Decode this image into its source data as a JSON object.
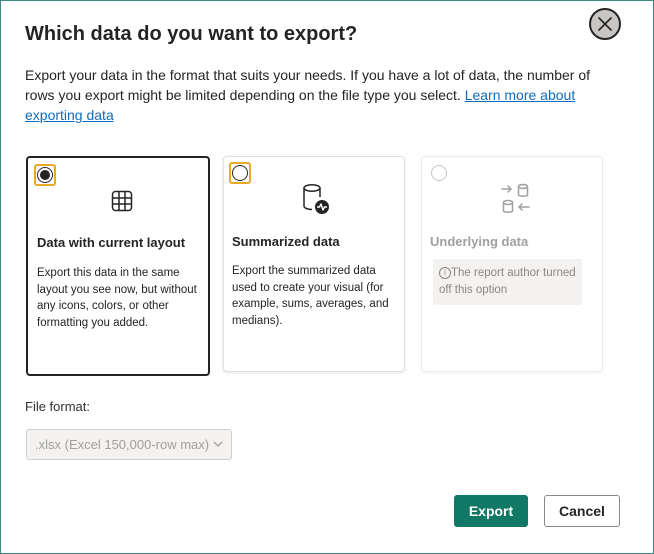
{
  "dialog": {
    "title": "Which data do you want to export?",
    "description_text": "Export your data in the format that suits your needs. If you have a lot of data, the number of rows you export might be limited depending on the file type you select. ",
    "learn_more_link": "Learn more about exporting data",
    "close_icon": "close-icon"
  },
  "options": [
    {
      "title": "Data with current layout",
      "description": "Export this data in the same layout you see now, but without any icons, colors, or other formatting you added.",
      "icon": "table-grid-icon",
      "selected": true,
      "enabled": true
    },
    {
      "title": "Summarized data",
      "description": "Export the summarized data used to create your visual (for example, sums, averages, and medians).",
      "icon": "database-summary-icon",
      "selected": false,
      "enabled": true
    },
    {
      "title": "Underlying data",
      "info": "The report author turned off this option",
      "icon": "data-transfer-icon",
      "selected": false,
      "enabled": false
    }
  ],
  "file_format": {
    "label": "File format:",
    "selected_value": ".xlsx (Excel 150,000-row max)"
  },
  "buttons": {
    "export": "Export",
    "cancel": "Cancel"
  },
  "colors": {
    "accent": "#117865",
    "focus_outline": "#e8a92b",
    "link": "#0f6cbd",
    "dialog_border": "#3a8f80"
  }
}
